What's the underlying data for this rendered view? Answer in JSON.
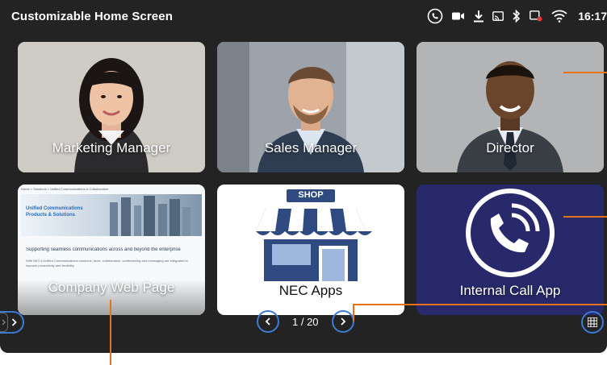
{
  "header": {
    "title": "Customizable Home Screen",
    "time": "16:17"
  },
  "status_icons": [
    "phone-call-icon",
    "video-camera-icon",
    "download-icon",
    "cast-icon",
    "bluetooth-icon",
    "battery-alert-icon",
    "wifi-icon"
  ],
  "tiles": [
    {
      "label": "Marketing Manager",
      "kind": "contact",
      "icon": "woman-portrait-photo"
    },
    {
      "label": "Sales Manager",
      "kind": "contact",
      "icon": "man-portrait-photo"
    },
    {
      "label": "Director",
      "kind": "contact",
      "icon": "man-portrait-photo"
    },
    {
      "label": "Company Web Page",
      "kind": "web-page"
    },
    {
      "label": "NEC Apps",
      "kind": "app-store",
      "shop_sign": "SHOP"
    },
    {
      "label": "Internal Call App",
      "kind": "app",
      "icon": "phone-call-icon"
    }
  ],
  "webpage_preview": {
    "breadcrumb": "Home > Solutions > Unified Communications & Collaboration",
    "banner_title": "Unified Communications\nProducts & Solutions",
    "headline": "Supporting seamless communications across and beyond the enterprise",
    "body": "With NEC's Unified Communications solutions, tools, collaboration, conferencing and messaging are integrated to improve productivity and flexibility."
  },
  "pagination": {
    "current": 1,
    "total": 20,
    "text": "1 / 20"
  },
  "colors": {
    "screen_bg": "#232323",
    "accent_blue": "#3b7bd4",
    "call_app_bg": "#27296a",
    "leader_orange": "#e8711c"
  }
}
